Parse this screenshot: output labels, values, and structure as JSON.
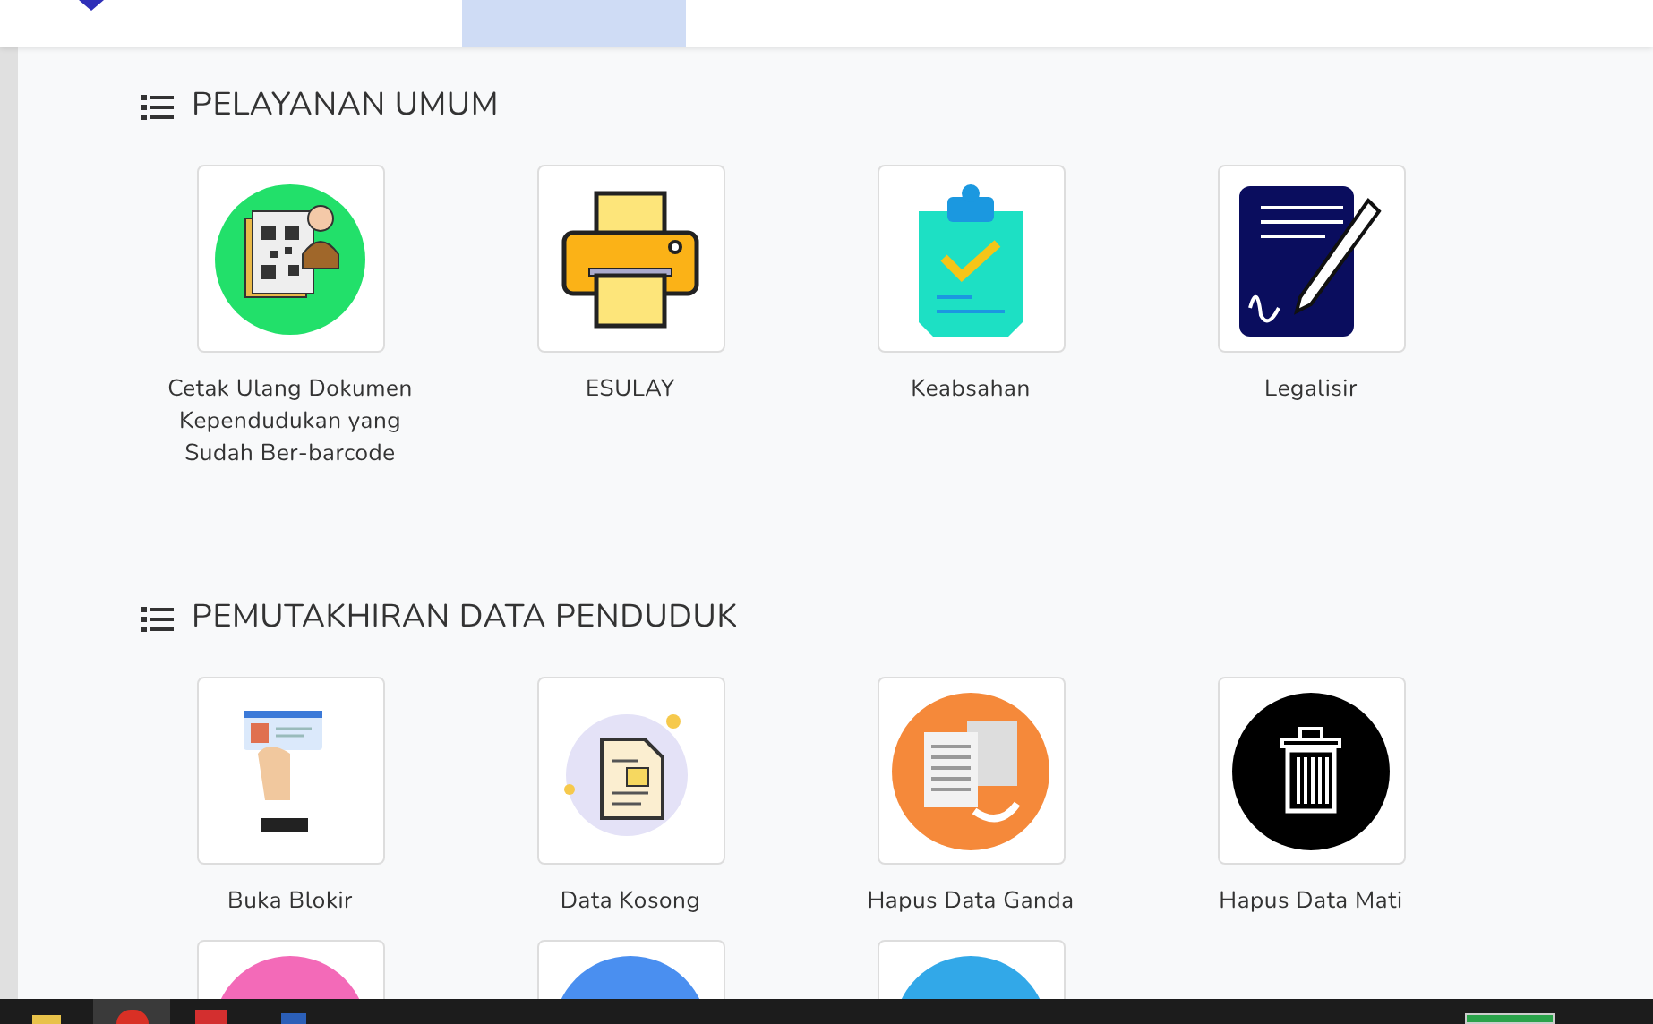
{
  "sections": [
    {
      "title": "PELAYANAN UMUM",
      "items": [
        {
          "label": "Cetak Ulang Dokumen Kependudukan yang Sudah Ber-barcode"
        },
        {
          "label": "ESULAY"
        },
        {
          "label": "Keabsahan"
        },
        {
          "label": "Legalisir"
        }
      ]
    },
    {
      "title": "PEMUTAKHIRAN DATA PENDUDUK",
      "items": [
        {
          "label": "Buka Blokir"
        },
        {
          "label": "Data Kosong"
        },
        {
          "label": "Hapus Data Ganda"
        },
        {
          "label": "Hapus Data Mati"
        }
      ]
    }
  ]
}
